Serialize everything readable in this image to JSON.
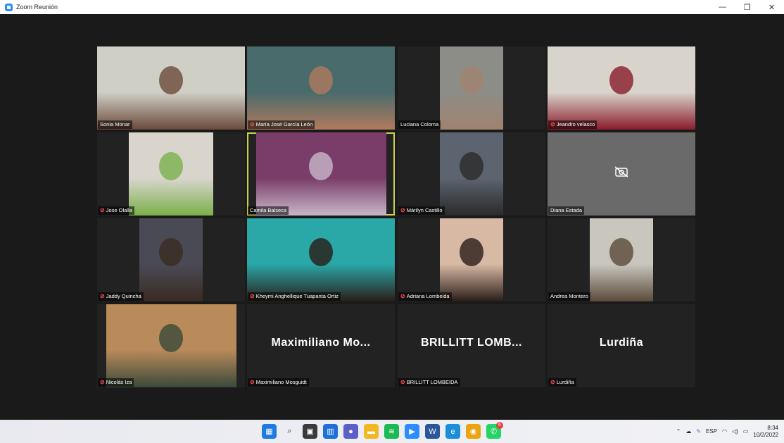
{
  "window": {
    "title": "Zoom Reunión",
    "minimize_glyph": "—",
    "restore_glyph": "❐",
    "close_glyph": "✕"
  },
  "participants": [
    {
      "name": "Sonia Monar",
      "muted": false,
      "video": true,
      "bg": "#cfcfc6",
      "fg": "#6b4a3a"
    },
    {
      "name": "María José García León",
      "muted": true,
      "video": true,
      "bg": "#4a6b6b",
      "fg": "#b07a5e"
    },
    {
      "name": "Luciana Coloma",
      "muted": false,
      "video": true,
      "bg": "#8d8d88",
      "fg": "#a0836e"
    },
    {
      "name": "Jeandro velasco",
      "muted": true,
      "video": true,
      "bg": "#d8d4cc",
      "fg": "#8a1c2a"
    },
    {
      "name": "Jose Olalla",
      "muted": true,
      "video": true,
      "bg": "#d9d5cd",
      "fg": "#7bb04b"
    },
    {
      "name": "Camila Balseca",
      "muted": false,
      "video": true,
      "bg": "#7a3d6a",
      "fg": "#c8b7c9",
      "active": true
    },
    {
      "name": "Márilyn Castillo",
      "muted": true,
      "video": true,
      "bg": "#5c6470",
      "fg": "#2a2a2a"
    },
    {
      "name": "Diana Estada",
      "muted": false,
      "video": false,
      "bg": "#6a6a6a"
    },
    {
      "name": "Jaddy Quincha",
      "muted": true,
      "video": true,
      "bg": "#4a4a55",
      "fg": "#3a2a22"
    },
    {
      "name": "Kheymi Anghellique Tuapanta Ortiz",
      "muted": true,
      "video": true,
      "bg": "#2aa7a7",
      "fg": "#2a1d18"
    },
    {
      "name": "Adriana Lombeida",
      "muted": true,
      "video": true,
      "bg": "#d8b9a4",
      "fg": "#2a1d18"
    },
    {
      "name": "Andrea Montero",
      "muted": false,
      "video": true,
      "bg": "#c8c6bd",
      "fg": "#5a4a3a"
    },
    {
      "name": "Nicolás Iza",
      "muted": true,
      "video": true,
      "bg": "#b98a5a",
      "fg": "#3a4a3a"
    },
    {
      "name": "Maximiliano Mosguidt",
      "muted": true,
      "video": false,
      "big": "Maximiliano  Mo..."
    },
    {
      "name": "BRILLITT LOMBEIDA",
      "muted": true,
      "video": false,
      "big": "BRILLITT  LOMB..."
    },
    {
      "name": "Lurdiña",
      "muted": true,
      "video": false,
      "big": "Lurdiña"
    }
  ],
  "taskbar": {
    "apps": [
      {
        "icon": "windows-start-icon",
        "color": "#1e7be0",
        "glyph": "▦"
      },
      {
        "icon": "search-icon",
        "color": "transparent",
        "glyph": "⌕"
      },
      {
        "icon": "task-view-icon",
        "color": "#3a3a3a",
        "glyph": "▣"
      },
      {
        "icon": "widgets-icon",
        "color": "#1e6fd9",
        "glyph": "▥"
      },
      {
        "icon": "teams-chat-icon",
        "color": "#5b5fc7",
        "glyph": "●"
      },
      {
        "icon": "file-explorer-icon",
        "color": "#f2b824",
        "glyph": "▬"
      },
      {
        "icon": "spotify-icon",
        "color": "#1db954",
        "glyph": "≋"
      },
      {
        "icon": "zoom-icon",
        "color": "#2d8cff",
        "glyph": "▶"
      },
      {
        "icon": "word-icon",
        "color": "#2b579a",
        "glyph": "W"
      },
      {
        "icon": "edge-icon",
        "color": "#1d8ed8",
        "glyph": "e"
      },
      {
        "icon": "chrome-icon",
        "color": "#e9a40f",
        "glyph": "◉"
      },
      {
        "icon": "whatsapp-icon",
        "color": "#25d366",
        "glyph": "✆",
        "badge": "6"
      }
    ],
    "tray": {
      "chevron": "⌃",
      "language": "ESP",
      "time": "8:34",
      "date": "10/2/2022"
    }
  }
}
